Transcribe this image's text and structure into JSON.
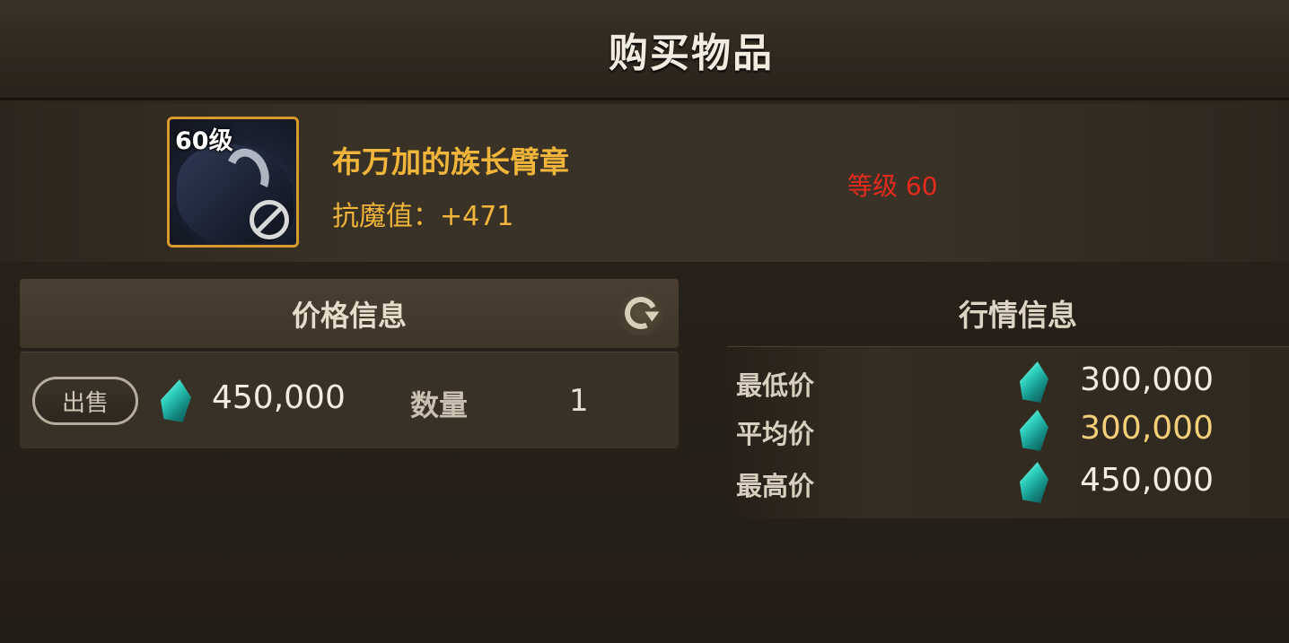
{
  "window": {
    "title": "购买物品"
  },
  "item": {
    "level_badge": "60级",
    "name": "布万加的族长臂章",
    "stat": "抗魔值：+471",
    "required_level": "等级 60",
    "icons": {
      "tradable_status": "no-sell-icon"
    }
  },
  "price_info": {
    "header": "价格信息",
    "refresh_icon": "refresh-icon",
    "sell_button": "出售",
    "currency_icon": "crystal-gem-icon",
    "price": "450,000",
    "quantity_label": "数量",
    "quantity": "1"
  },
  "market_info": {
    "header": "行情信息",
    "rows": [
      {
        "label": "最低价",
        "value": "300,000"
      },
      {
        "label": "平均价",
        "value": "300,000"
      },
      {
        "label": "最高价",
        "value": "450,000"
      }
    ]
  },
  "colors": {
    "item_name": "#f0b53a",
    "required_level": "#e52a1e",
    "average_price": "#f4cf7a",
    "icon_border": "#d79a2c"
  }
}
